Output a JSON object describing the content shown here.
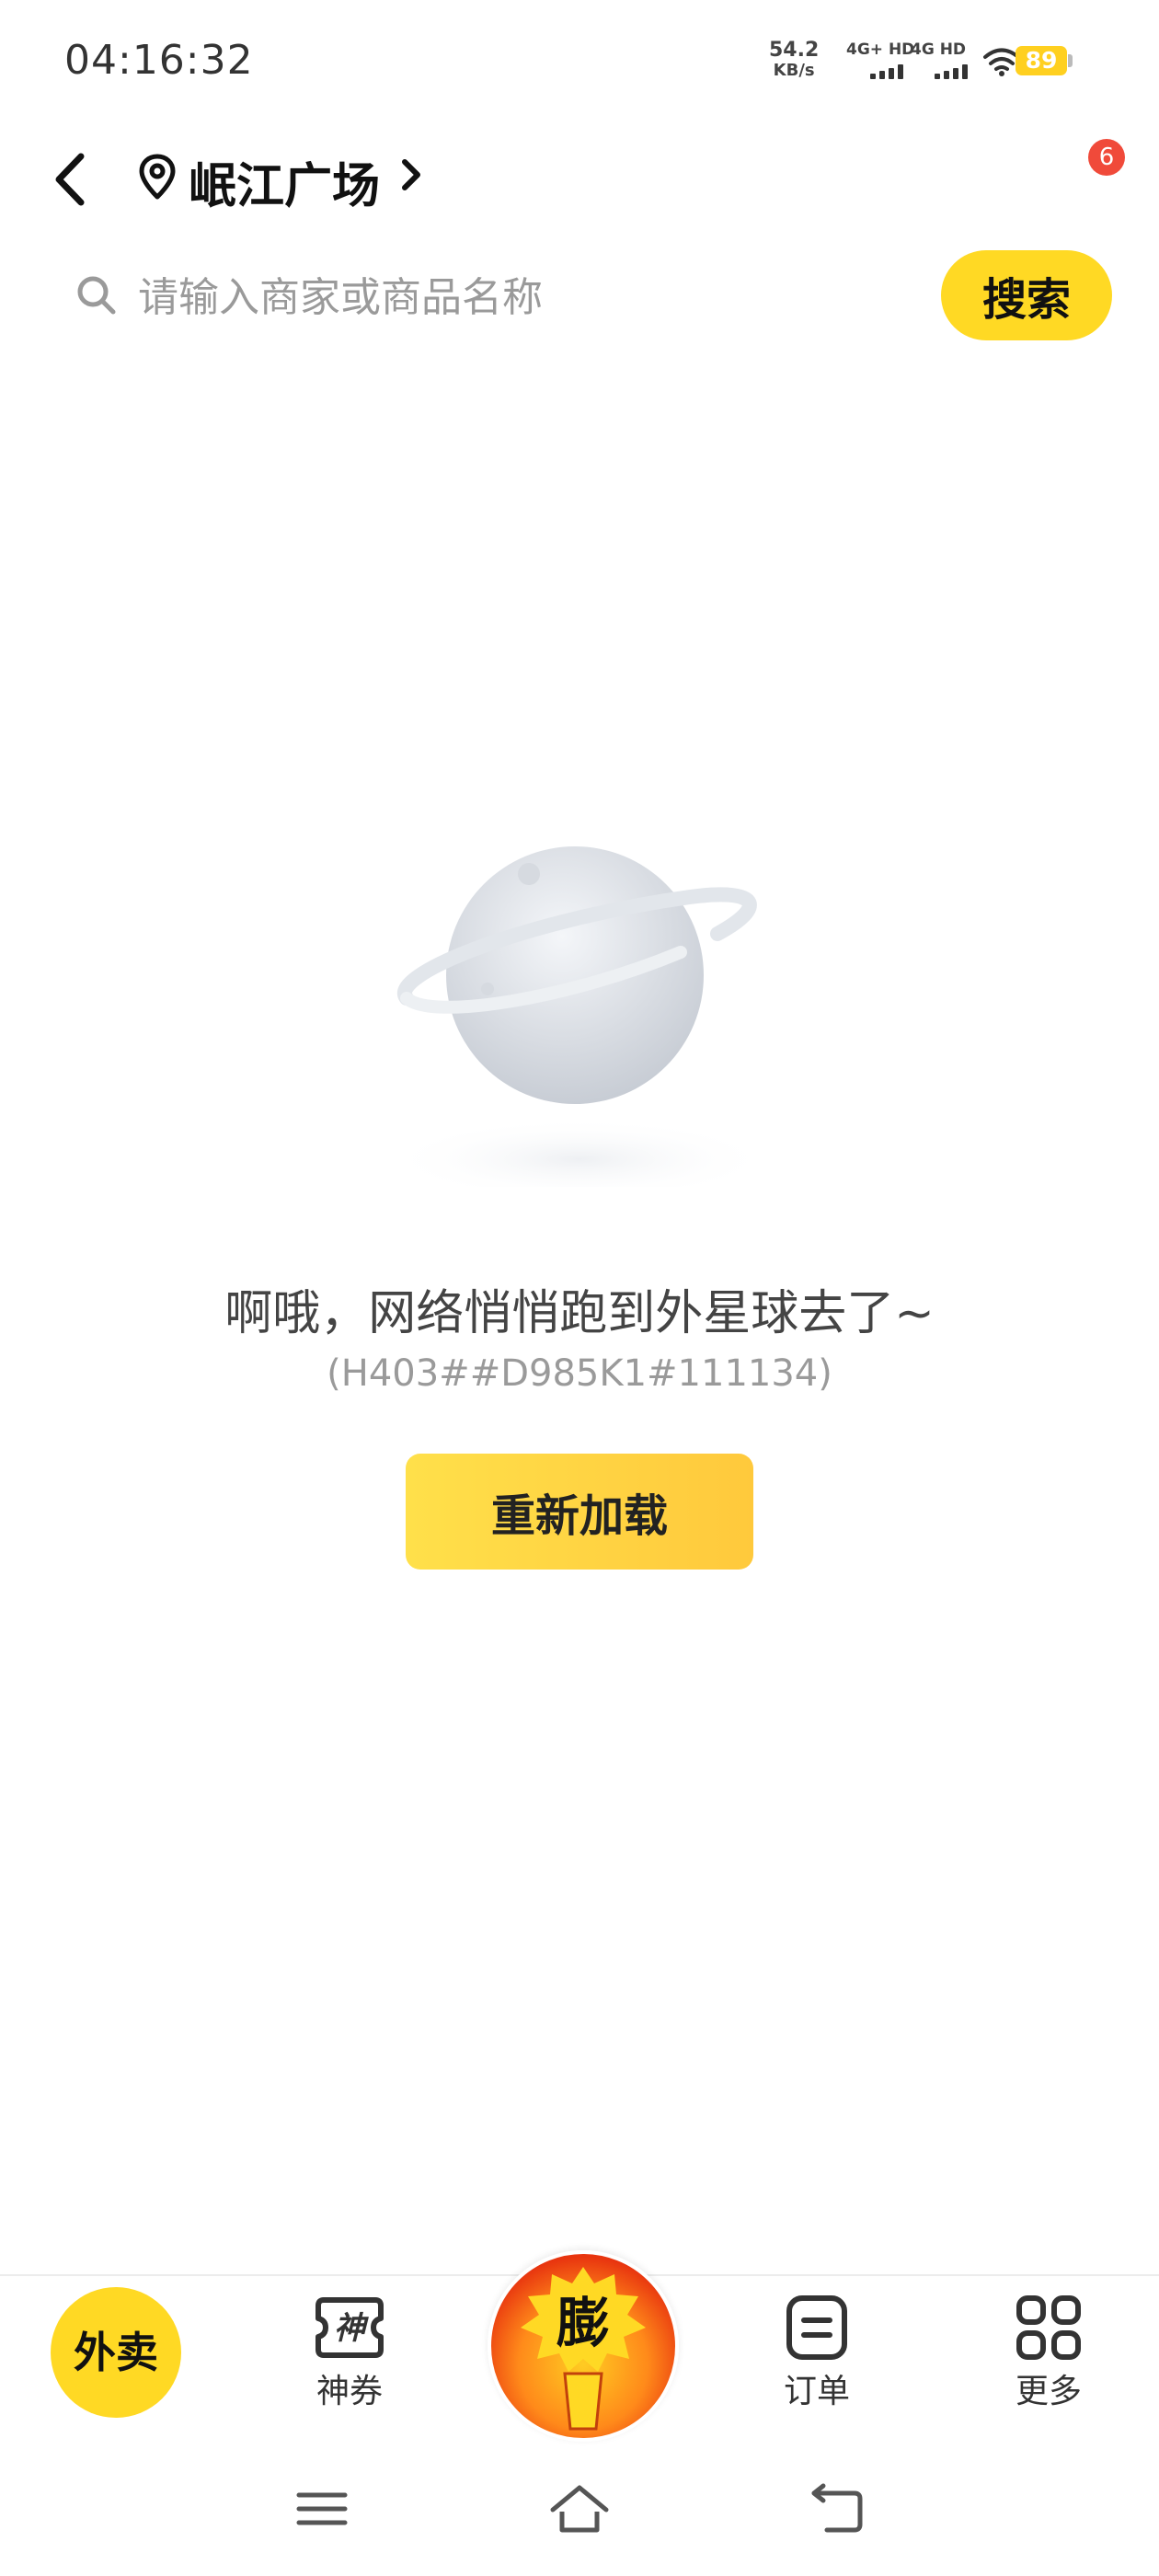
{
  "status_bar": {
    "time": "04:16:32",
    "net_speed_value": "54.2",
    "net_speed_unit": "KB/s",
    "sim1_label": "4G+ HD",
    "sim2_label": "4G HD",
    "battery": "89",
    "battery_color": "#ffd020"
  },
  "header": {
    "location": "岷江广场",
    "badge_count": "6"
  },
  "search": {
    "placeholder": "请输入商家或商品名称",
    "button_label": "搜索"
  },
  "error": {
    "title": "啊哦，网络悄悄跑到外星球去了~",
    "code": "(H403##D985K1#111134)",
    "reload_label": "重新加载"
  },
  "bottom_nav": {
    "items": [
      {
        "label": "外卖",
        "icon": "waimai-logo",
        "active": true
      },
      {
        "label": "神券",
        "icon": "coupon-icon"
      },
      {
        "label": "膨",
        "icon": "promo-center-icon"
      },
      {
        "label": "订单",
        "icon": "order-icon"
      },
      {
        "label": "更多",
        "icon": "grid-icon"
      }
    ]
  },
  "colors": {
    "accent": "#ffd924",
    "badge": "#f04a3a"
  }
}
